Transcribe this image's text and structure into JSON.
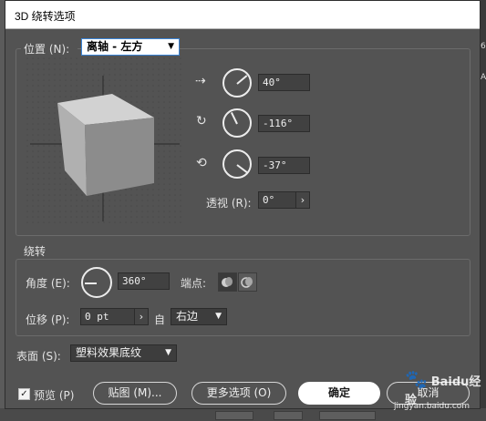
{
  "dialog": {
    "title": "3D 绕转选项"
  },
  "position": {
    "label": "位置 (N):",
    "preset": "离轴 - 左方",
    "x_angle": "40°",
    "y_angle": "-116°",
    "z_angle": "-37°",
    "perspective_label": "透视 (R):",
    "perspective_value": "0°"
  },
  "revolve": {
    "heading": "绕转",
    "angle_label": "角度 (E):",
    "angle_value": "360°",
    "cap_label": "端点:",
    "offset_label": "位移 (P):",
    "offset_value": "0 pt",
    "from_label": "自",
    "from_value": "右边"
  },
  "surface": {
    "label": "表面 (S):",
    "value": "塑料效果底纹"
  },
  "footer": {
    "preview_label": "预览 (P)",
    "preview_checked": true,
    "map_art_label": "贴图 (M)...",
    "more_options_label": "更多选项 (O)",
    "ok_label": "确定",
    "cancel_label": "取消"
  },
  "background_strip": {
    "top_char": "6",
    "side_char": "A"
  },
  "watermark": {
    "brand": "Baidu经验",
    "url": "jingyan.baidu.com"
  },
  "icons": {
    "x_axis": "rotate-x-axis-icon",
    "y_axis": "rotate-y-axis-icon",
    "z_axis": "rotate-z-axis-icon",
    "cap_on": "cap-on-icon",
    "cap_off": "cap-off-icon"
  },
  "colors": {
    "dialog_bg": "#535353",
    "focus_ring": "#3a84d6",
    "cube_front": "#8c8c8c",
    "cube_top": "#d2d2d2",
    "cube_side": "#b0b0b0"
  }
}
